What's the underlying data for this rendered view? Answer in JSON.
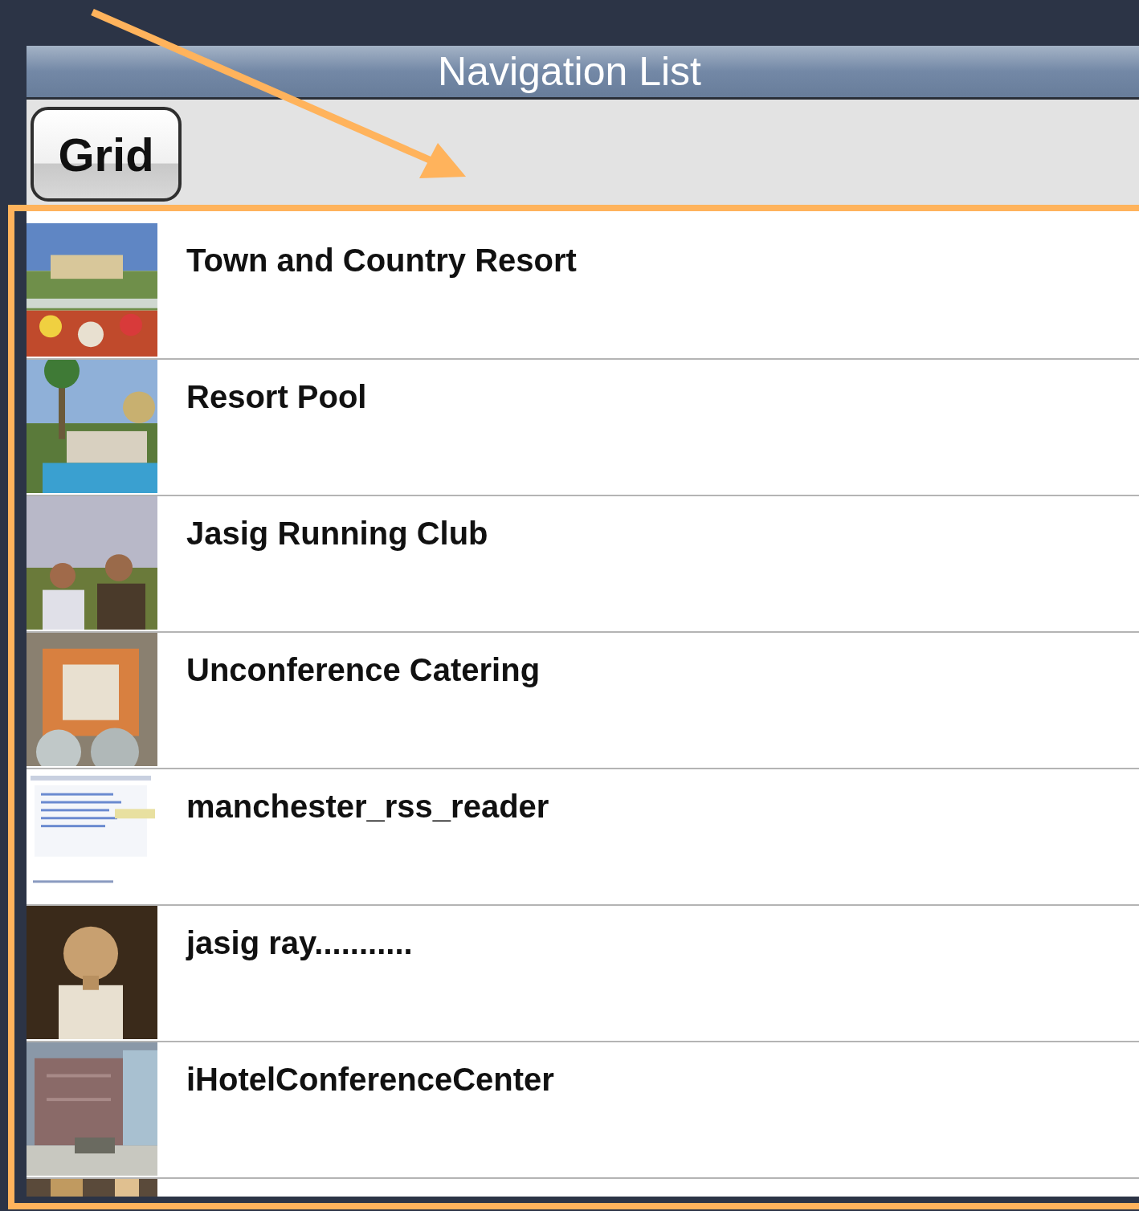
{
  "title_bar": {
    "title": "Navigation List"
  },
  "toolbar": {
    "button": "Grid"
  },
  "list": {
    "rows": [
      {
        "title": "Town and Country Resort"
      },
      {
        "title": "Resort Pool"
      },
      {
        "title": "Jasig Running Club"
      },
      {
        "title": "Unconference Catering"
      },
      {
        "title": "manchester_rss_reader"
      },
      {
        "title": "jasig ray..........."
      },
      {
        "title": "iHotelConferenceCenter"
      }
    ]
  }
}
